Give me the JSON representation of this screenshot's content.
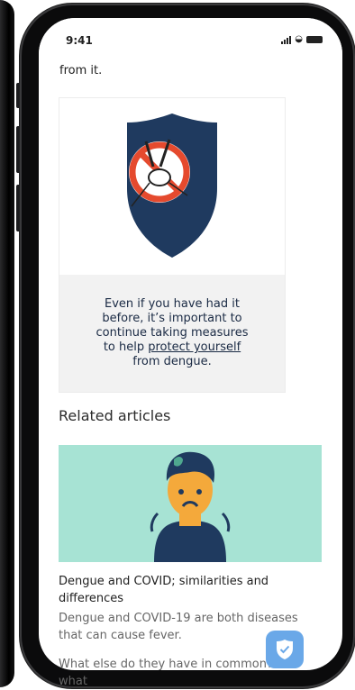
{
  "status_bar": {
    "time": "9:41"
  },
  "page": {
    "cut_text": "dengue once doesn't make you entirely safe from it."
  },
  "card": {
    "caption_before": "Even if you have had it before, it’s important to continue taking measures to help ",
    "caption_link": "protect yourself",
    "caption_after": " from dengue."
  },
  "related": {
    "heading": "Related articles",
    "article": {
      "title": "Dengue and COVID; similarities and differences",
      "description": "Dengue and COVID-19 are both diseases that can cause fever.",
      "description_cut": "What else do they have in common? And what"
    }
  },
  "colors": {
    "shield_navy": "#1f3a5f",
    "article_bg": "#a7e3d4",
    "fab_blue": "#6aa8e8"
  }
}
